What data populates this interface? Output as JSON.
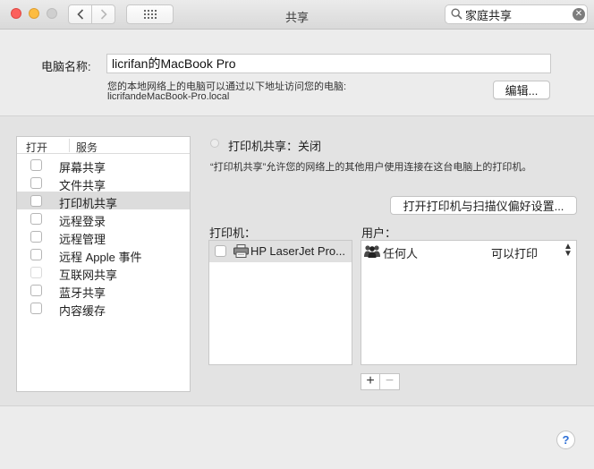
{
  "window": {
    "title": "共享",
    "search": {
      "value": "家庭共享"
    }
  },
  "computer_name": {
    "label": "电脑名称:",
    "value": "licrifan的MacBook Pro",
    "description": "您的本地网络上的电脑可以通过以下地址访问您的电脑:",
    "address": "licrifandeMacBook-Pro.local",
    "edit_button": "编辑..."
  },
  "services": {
    "header_on": "打开",
    "header_service": "服务",
    "items": [
      {
        "label": "屏幕共享",
        "checked": false,
        "selected": false
      },
      {
        "label": "文件共享",
        "checked": false,
        "selected": false
      },
      {
        "label": "打印机共享",
        "checked": false,
        "selected": true
      },
      {
        "label": "远程登录",
        "checked": false,
        "selected": false
      },
      {
        "label": "远程管理",
        "checked": false,
        "selected": false
      },
      {
        "label": "远程 Apple 事件",
        "checked": false,
        "selected": false
      },
      {
        "label": "互联网共享",
        "checked": false,
        "selected": false,
        "disabled": true
      },
      {
        "label": "蓝牙共享",
        "checked": false,
        "selected": false
      },
      {
        "label": "内容缓存",
        "checked": false,
        "selected": false
      }
    ]
  },
  "printer_sharing": {
    "status": "打印机共享：关闭",
    "description": "“打印机共享”允许您的网络上的其他用户使用连接在这台电脑上的打印机。",
    "open_prefs_button": "打开打印机与扫描仪偏好设置...",
    "printers_label": "打印机：",
    "users_label": "用户：",
    "printers": [
      {
        "name": "HP LaserJet Pro...",
        "checked": false
      }
    ],
    "users": [
      {
        "name": "任何人",
        "permission": "可以打印"
      }
    ],
    "add_label": "+",
    "remove_label": "−"
  },
  "help": {
    "label": "?"
  },
  "colors": {
    "accent": "#2e6fd6",
    "close": "#fc605c",
    "minimize": "#fdbc40"
  },
  "icons": [
    "back-icon",
    "forward-icon",
    "grid-icon",
    "search-icon",
    "clear-icon",
    "printer-icon",
    "group-icon",
    "help-icon"
  ]
}
